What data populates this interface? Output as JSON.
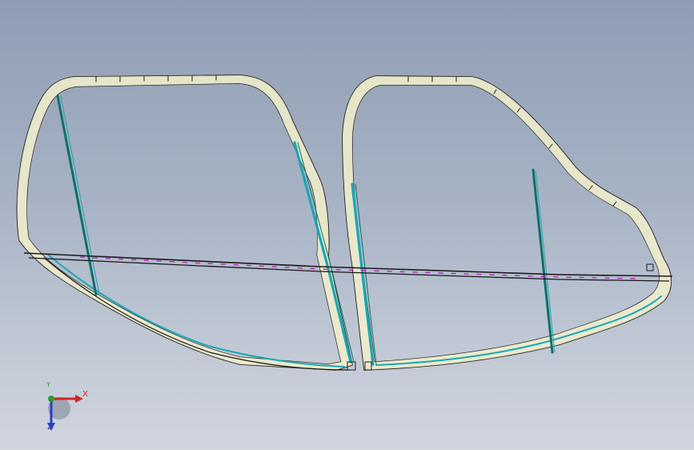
{
  "viewport": {
    "background_top": "#8f9db3",
    "background_bottom": "#d0d5de",
    "model": "car-door-frames-pair",
    "line_colors": {
      "outline": "#1b1b1b",
      "fill_cream": "#f2f0cc",
      "accent_cyan": "#1aa7b5",
      "accent_teal": "#0f6f6a",
      "accent_magenta": "#c020c0"
    }
  },
  "triad": {
    "x_label": "X",
    "y_label": "Y",
    "z_label": "Z",
    "x_color": "#d32626",
    "y_color": "#2a9d2a",
    "z_color": "#2a3fc4"
  }
}
